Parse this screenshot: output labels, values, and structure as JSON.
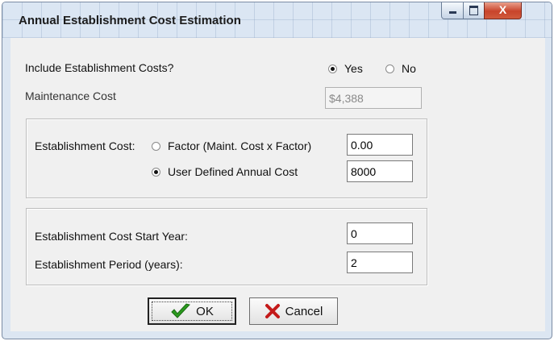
{
  "window": {
    "title": "Annual Establishment Cost Estimation",
    "controls": {
      "minimize": "minimize",
      "maximize": "maximize",
      "close": "X"
    }
  },
  "include_costs": {
    "label": "Include Establishment Costs?",
    "options": [
      {
        "label": "Yes",
        "selected": true
      },
      {
        "label": "No",
        "selected": false
      }
    ]
  },
  "maintenance": {
    "label": "Maintenance Cost",
    "value": "$4,388",
    "enabled": false
  },
  "establishment": {
    "label": "Establishment Cost:",
    "factor": {
      "label": "Factor (Maint. Cost x Factor)",
      "selected": false,
      "value": "0.00"
    },
    "user_defined": {
      "label": "User Defined Annual Cost",
      "selected": true,
      "value": "8000"
    }
  },
  "schedule": {
    "start_year": {
      "label": "Establishment Cost Start Year:",
      "value": "0"
    },
    "period": {
      "label": "Establishment Period (years):",
      "value": "2"
    }
  },
  "buttons": {
    "ok": {
      "label": "OK",
      "icon": "checkmark-icon",
      "color": "#2a9a1e"
    },
    "cancel": {
      "label": "Cancel",
      "icon": "x-icon",
      "color": "#c41a1a"
    }
  }
}
